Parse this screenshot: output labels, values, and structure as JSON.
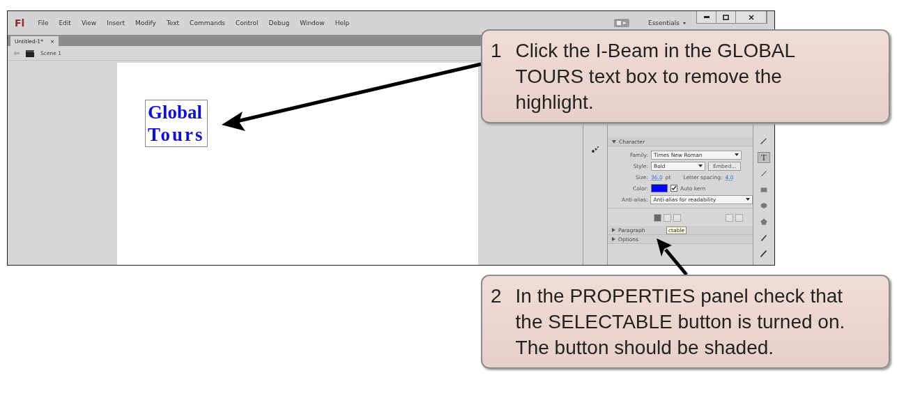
{
  "window": {
    "logo": "Fl",
    "menu": [
      "File",
      "Edit",
      "View",
      "Insert",
      "Modify",
      "Text",
      "Commands",
      "Control",
      "Debug",
      "Window",
      "Help"
    ],
    "workspace": "Essentials"
  },
  "tabs": [
    {
      "label": "Untitled-1*",
      "close": "×",
      "selected": true
    }
  ],
  "scene": {
    "label": "Scene 1"
  },
  "stage": {
    "text_lines": [
      "Global",
      "Tours"
    ]
  },
  "properties": {
    "section": "Character",
    "fields": [
      {
        "kind": "select",
        "label": "Family:",
        "value": "Times New Roman"
      },
      {
        "kind": "style",
        "label": "Style:",
        "value": "Bold",
        "button": "Embed..."
      },
      {
        "kind": "size",
        "label": "Size:",
        "value": "36.0",
        "unit": "pt",
        "extra_label": "Letter spacing:",
        "extra_value": "4.0"
      },
      {
        "kind": "color",
        "label": "Color:",
        "color": "#0000ff",
        "checkbox": "Auto kern",
        "checked": true
      },
      {
        "kind": "select",
        "label": "Anti-alias:",
        "value": "Anti-alias for readability"
      }
    ],
    "buttons": [
      {
        "selected": true
      },
      {
        "selected": false
      },
      {
        "selected": false
      }
    ],
    "tooltip": "ctable",
    "sections": [
      {
        "label": "Paragraph",
        "expanded": false
      },
      {
        "label": "Options",
        "expanded": false
      }
    ]
  },
  "tools": [
    {
      "selected": false
    },
    {
      "selected": true,
      "glyph": "T"
    },
    {
      "selected": false
    },
    {
      "selected": false
    },
    {
      "selected": false
    },
    {
      "selected": false
    },
    {
      "selected": false
    },
    {
      "selected": false
    }
  ],
  "callouts": [
    {
      "number": "1",
      "text": "Click the I-Beam in the GLOBAL TOURS text box to remove the highlight."
    },
    {
      "number": "2",
      "text": "In the PROPERTIES panel check that the SELECTABLE button is turned on. The button should be shaded."
    }
  ]
}
